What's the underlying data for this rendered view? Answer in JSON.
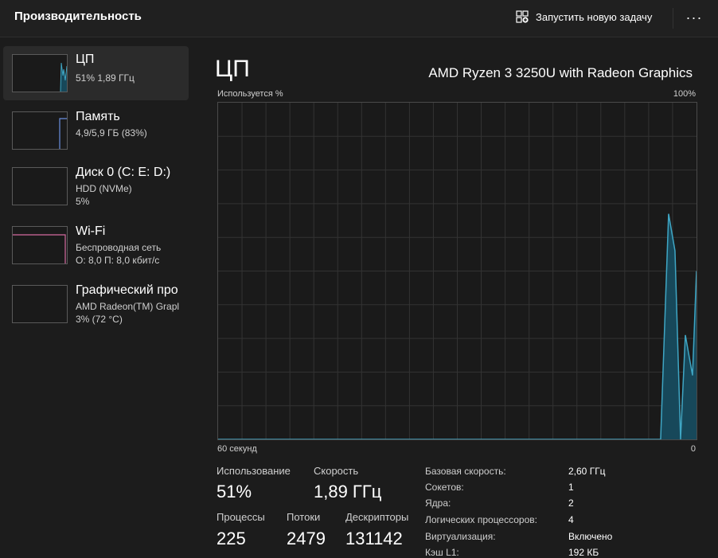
{
  "header": {
    "title": "Производительность",
    "run_task_label": "Запустить новую задачу",
    "more_label": "···"
  },
  "sidebar": {
    "items": [
      {
        "title": "ЦП",
        "line1": "51% 1,89 ГГц",
        "line2": ""
      },
      {
        "title": "Память",
        "line1": "4,9/5,9 ГБ (83%)",
        "line2": ""
      },
      {
        "title": "Диск 0 (C: E: D:)",
        "line1": "HDD (NVMe)",
        "line2": "5%"
      },
      {
        "title": "Wi-Fi",
        "line1": "Беспроводная сеть",
        "line2": "О: 8,0 П: 8,0 кбит/с"
      },
      {
        "title": "Графический про",
        "line1": "AMD Radeon(TM) Grapl",
        "line2": "3% (72 °C)"
      }
    ]
  },
  "main": {
    "title": "ЦП",
    "model": "AMD Ryzen 3 3250U with Radeon Graphics",
    "graph": {
      "top_left": "Используется %",
      "top_right": "100%",
      "bottom_left": "60 секунд",
      "bottom_right": "0"
    },
    "stats": {
      "usage_label": "Использование",
      "usage_value": "51%",
      "speed_label": "Скорость",
      "speed_value": "1,89 ГГц",
      "processes_label": "Процессы",
      "processes_value": "225",
      "threads_label": "Потоки",
      "threads_value": "2479",
      "handles_label": "Дескрипторы",
      "handles_value": "131142"
    },
    "info": [
      {
        "key": "Базовая скорость:",
        "value": "2,60 ГГц"
      },
      {
        "key": "Сокетов:",
        "value": "1"
      },
      {
        "key": "Ядра:",
        "value": "2"
      },
      {
        "key": "Логических процессоров:",
        "value": "4"
      },
      {
        "key": "Виртуализация:",
        "value": "Включено"
      },
      {
        "key": "Кэш L1:",
        "value": "192 КБ"
      }
    ]
  },
  "colors": {
    "cpu_line": "#3fa6c4",
    "cpu_fill": "#17485a",
    "memory_line": "#6b8fe0",
    "wifi_line": "#d56aa0"
  },
  "chart_data": {
    "type": "area",
    "ylim": [
      0,
      100
    ],
    "x_seconds_ago": [
      60,
      4.5,
      3.5,
      2.7,
      2.0,
      1.4,
      0.5,
      0
    ],
    "y_percent": [
      0,
      0,
      67,
      56,
      0,
      31,
      19,
      50
    ]
  }
}
